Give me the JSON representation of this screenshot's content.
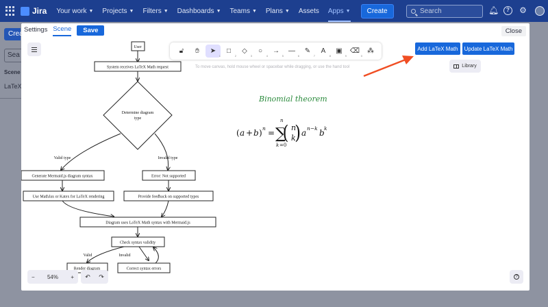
{
  "topbar": {
    "app_name": "Jira",
    "nav": [
      {
        "label": "Your work",
        "caret": true
      },
      {
        "label": "Projects",
        "caret": true
      },
      {
        "label": "Filters",
        "caret": true
      },
      {
        "label": "Dashboards",
        "caret": true
      },
      {
        "label": "Teams",
        "caret": true
      },
      {
        "label": "Plans",
        "caret": true
      },
      {
        "label": "Assets",
        "caret": false
      },
      {
        "label": "Apps",
        "caret": true,
        "active": true
      }
    ],
    "create_label": "Create",
    "search_placeholder": "Search"
  },
  "background_page": {
    "create_partial": "Crea",
    "search_partial": "Sea",
    "scene_partial": "Scene N",
    "latex_partial": "LaTeX"
  },
  "modal": {
    "tab_settings": "Settings",
    "tab_scene": "Scene",
    "save_label": "Save",
    "close_label": "Close",
    "add_latex_label": "Add LaTeX Math",
    "update_latex_label": "Update LaTeX Math",
    "library_label": "Library",
    "hint": "To move canvas, hold mouse wheel or spacebar while dragging, or use the hand tool",
    "zoom": "54%",
    "binomial_title": "Binomial theorem",
    "tools": [
      {
        "icon": "lock-icon",
        "glyph": "🔓︎",
        "num": ""
      },
      {
        "icon": "hand-icon",
        "glyph": "✋︎",
        "num": ""
      },
      {
        "icon": "selection-icon",
        "glyph": "➤",
        "num": "1",
        "active": true
      },
      {
        "icon": "rectangle-icon",
        "glyph": "□",
        "num": "2"
      },
      {
        "icon": "diamond-icon",
        "glyph": "◇",
        "num": "3"
      },
      {
        "icon": "ellipse-icon",
        "glyph": "○",
        "num": "4"
      },
      {
        "icon": "arrow-icon",
        "glyph": "→",
        "num": "5"
      },
      {
        "icon": "line-icon",
        "glyph": "—",
        "num": "6"
      },
      {
        "icon": "draw-icon",
        "glyph": "✎",
        "num": "7"
      },
      {
        "icon": "text-icon",
        "glyph": "A",
        "num": "8"
      },
      {
        "icon": "image-icon",
        "glyph": "▣",
        "num": "9"
      },
      {
        "icon": "eraser-icon",
        "glyph": "⌫",
        "num": "0"
      },
      {
        "icon": "shapes-icon",
        "glyph": "⁂",
        "num": ""
      }
    ]
  },
  "diagram": {
    "user": "User",
    "request": "System receives LaTeX Math request",
    "determine_line1": "Determine diagram",
    "determine_line2": "type",
    "valid_type": "Valid type",
    "invalid_type": "Invalid type",
    "generate": "Generate Mermaid.js diagram syntax",
    "error": "Error: Not supported",
    "use_mathjax": "Use MathJax or Katex for LaTeX rendering",
    "feedback": "Provide feedback on supported types",
    "uses_latex": "Diagram uses LaTeX Math syntax with Mermaid.js",
    "check": "Check syntax validity",
    "valid": "Valid",
    "invalid": "Invalid",
    "render": "Render diagram",
    "correct": "Correct syntax errors"
  },
  "colors": {
    "topbar": "#1d3f8f",
    "accent": "#1868db",
    "annotation_arrow": "#f04e23",
    "binomial_green": "#2a8a3c"
  }
}
